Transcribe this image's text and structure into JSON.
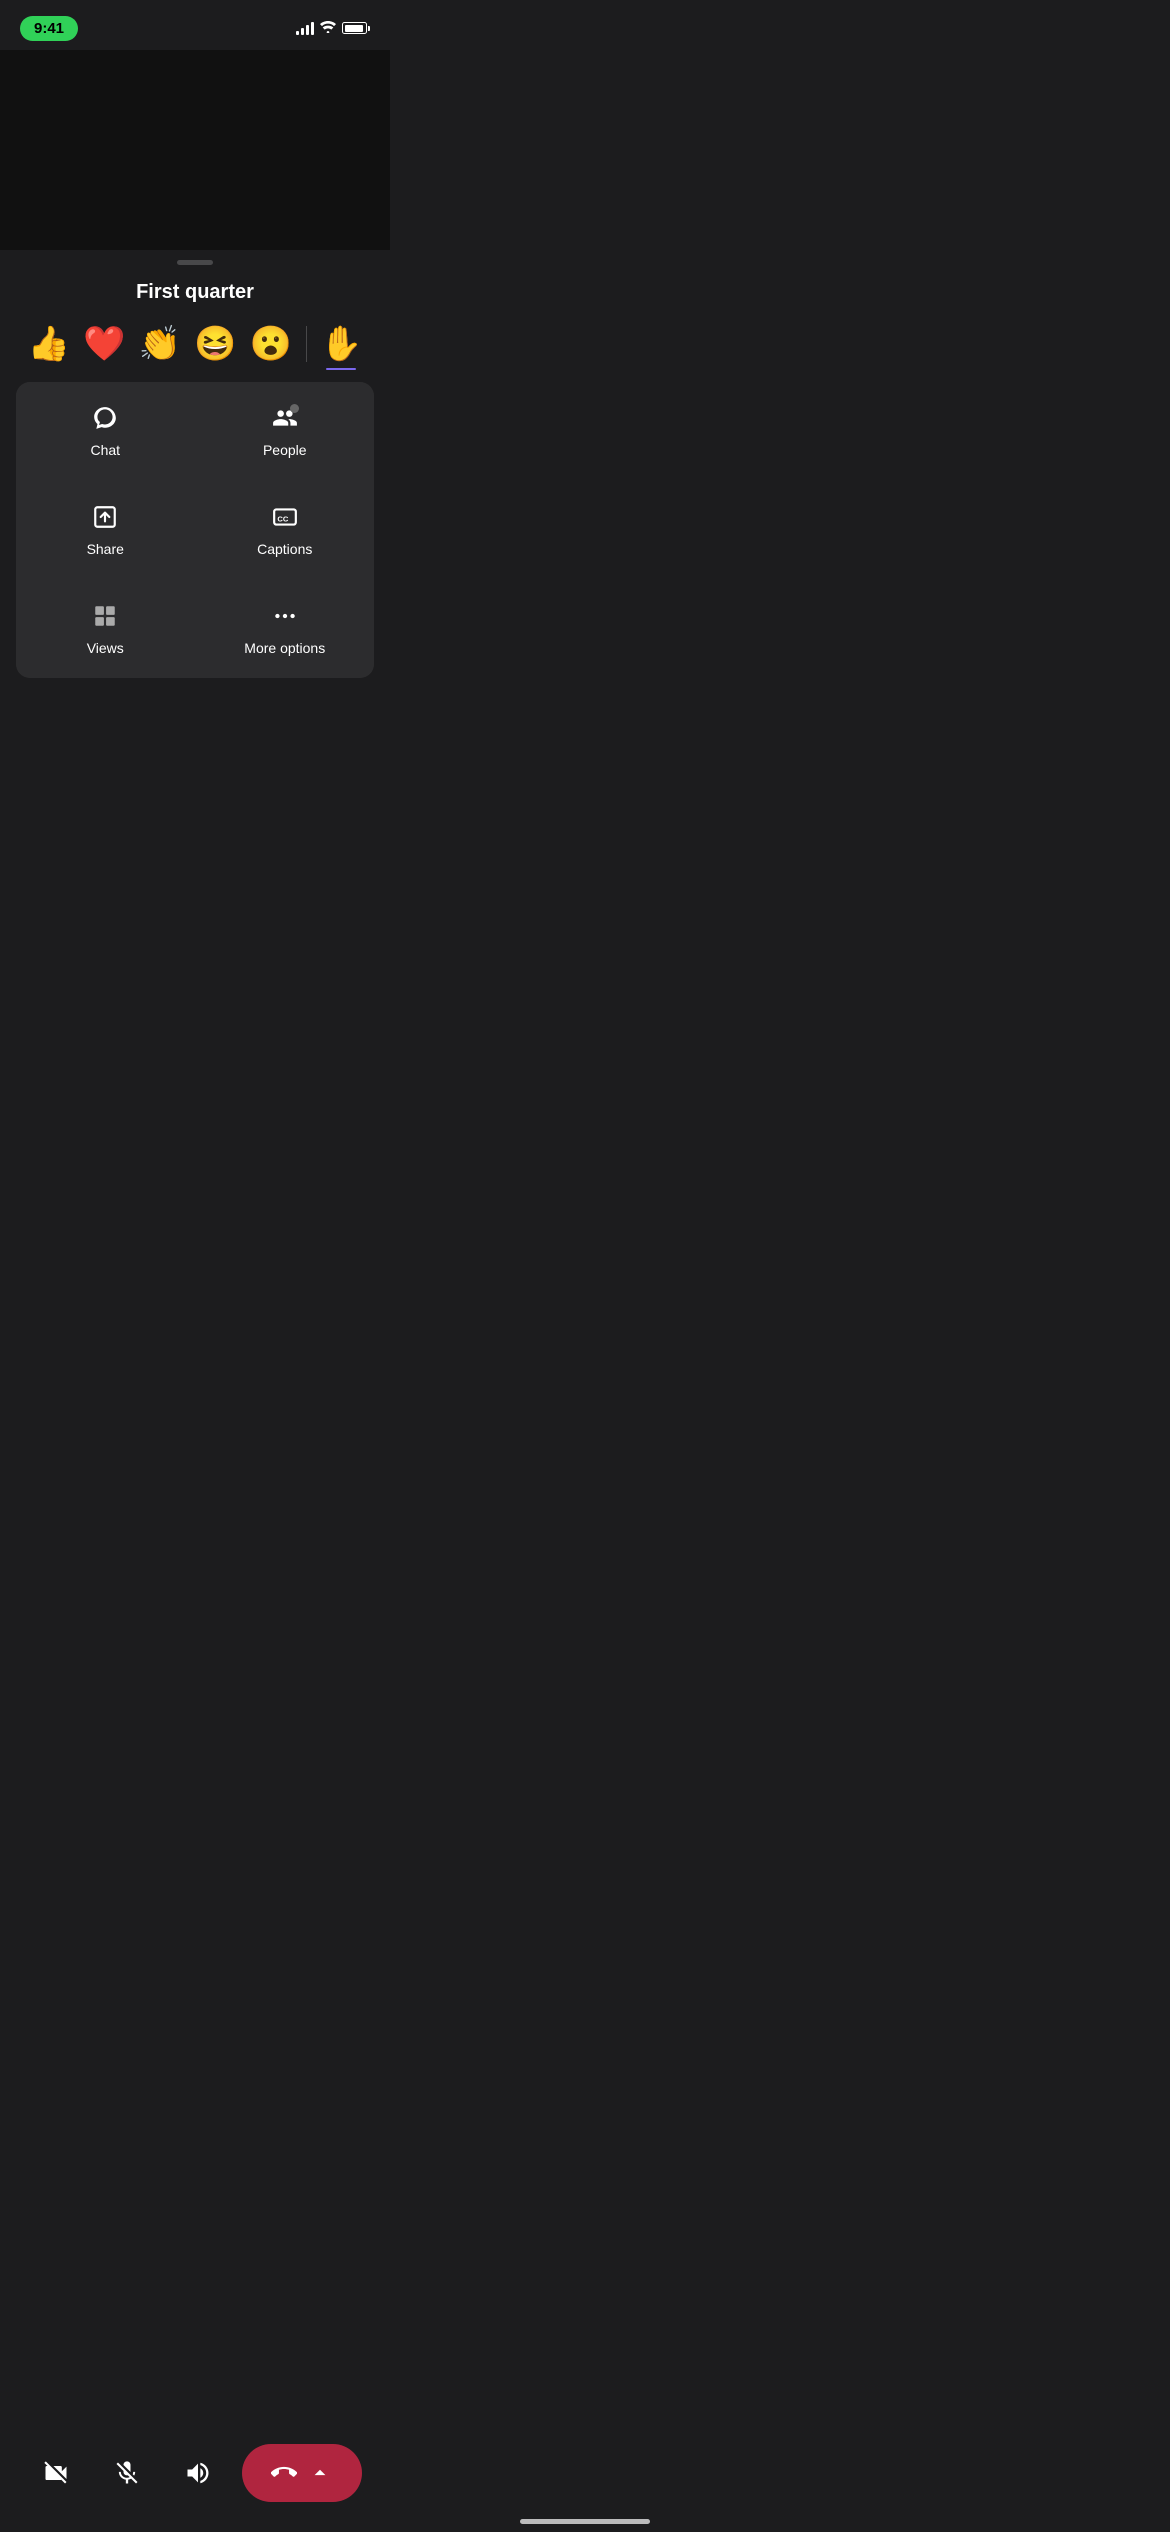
{
  "statusBar": {
    "time": "9:41",
    "signals": 4,
    "battery": 90
  },
  "sheet": {
    "title": "First quarter",
    "dragHandle": true
  },
  "emojis": [
    {
      "symbol": "👍",
      "name": "thumbs-up"
    },
    {
      "symbol": "❤️",
      "name": "heart"
    },
    {
      "symbol": "👏",
      "name": "clapping"
    },
    {
      "symbol": "😆",
      "name": "laughing"
    },
    {
      "symbol": "😮",
      "name": "surprised"
    }
  ],
  "raiseHand": {
    "symbol": "✋",
    "name": "raise-hand"
  },
  "gridItems": [
    {
      "id": "chat",
      "label": "Chat",
      "icon": "chat"
    },
    {
      "id": "people",
      "label": "People",
      "icon": "people"
    },
    {
      "id": "share",
      "label": "Share",
      "icon": "share"
    },
    {
      "id": "captions",
      "label": "Captions",
      "icon": "captions"
    },
    {
      "id": "views",
      "label": "Views",
      "icon": "views"
    },
    {
      "id": "more-options",
      "label": "More options",
      "icon": "more"
    }
  ],
  "controls": {
    "video": {
      "label": "Video off",
      "muted": true
    },
    "mic": {
      "label": "Mute",
      "muted": true
    },
    "audio": {
      "label": "Audio",
      "muted": false
    },
    "endCall": {
      "label": "End call"
    }
  }
}
